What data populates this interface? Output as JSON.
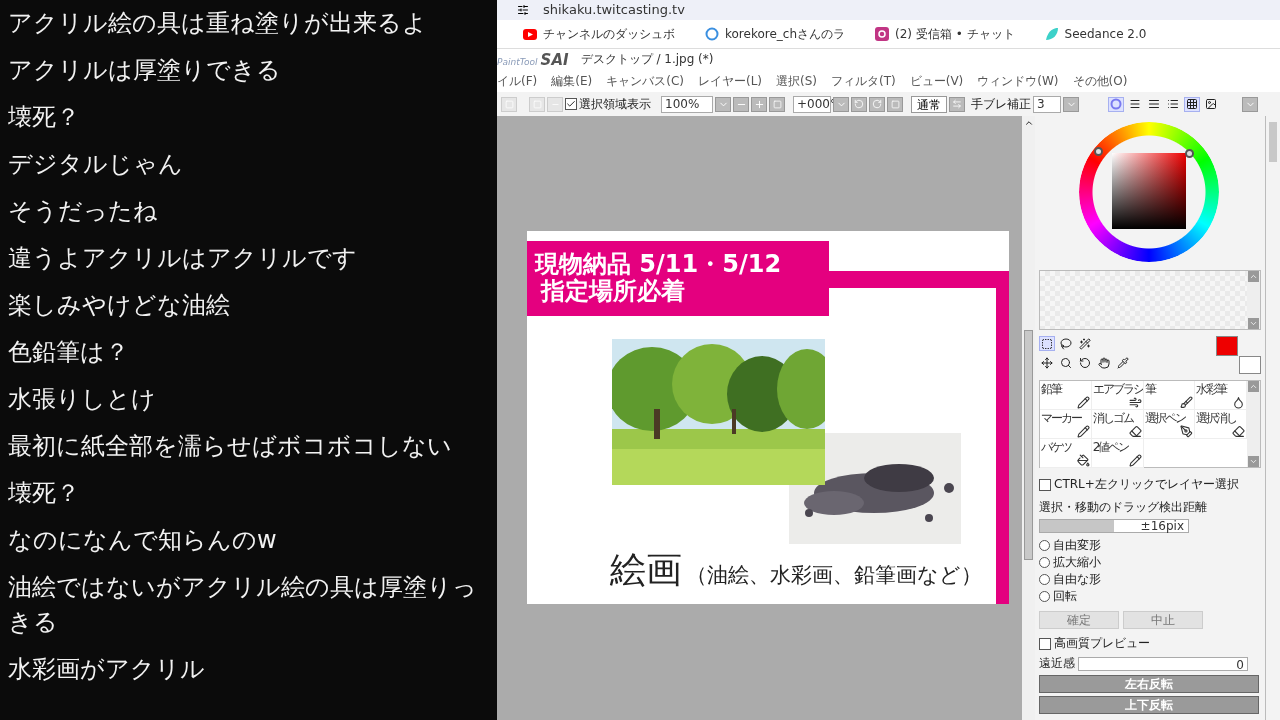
{
  "chat": {
    "messages": [
      {
        "lines": [
          "アクリル絵の具は重ね塗りが出来るよ"
        ]
      },
      {
        "lines": [
          "アクリルは厚塗りできる"
        ]
      },
      {
        "lines": [
          "壊死？"
        ]
      },
      {
        "lines": [
          "デジタルじゃん"
        ]
      },
      {
        "lines": [
          "そうだったね"
        ]
      },
      {
        "lines": [
          "違うよアクリルはアクリルです"
        ]
      },
      {
        "lines": [
          "楽しみやけどな油絵"
        ]
      },
      {
        "lines": [
          "色鉛筆は？"
        ]
      },
      {
        "lines": [
          "水張りしとけ"
        ]
      },
      {
        "lines": [
          "最初に紙全部を濡らせばボコボコしない"
        ]
      },
      {
        "lines": [
          "壊死？"
        ]
      },
      {
        "lines": [
          "なのになんで知らんのw"
        ]
      },
      {
        "lines": [
          "油絵ではないがアクリル絵の具は厚塗りっ",
          "きる"
        ]
      },
      {
        "lines": [
          "水彩画がアクリル"
        ]
      }
    ]
  },
  "browser": {
    "url": "shikaku.twitcasting.tv",
    "bookmarks": [
      {
        "kind": "video",
        "label": "チャンネルのダッシュボ"
      },
      {
        "kind": "ring",
        "label": "korekore_chさんのラ"
      },
      {
        "label": "(2) 受信箱 • チャット"
      },
      {
        "kind": "leaf",
        "label": "Seedance 2.0"
      }
    ]
  },
  "sai": {
    "logo_small": "PaintTool",
    "logo": "SAI",
    "title": "デスクトップ / 1.jpg (*)",
    "menu": [
      "イル(F)",
      "編集(E)",
      "キャンバス(C)",
      "レイヤー(L)",
      "選択(S)",
      "フィルタ(T)",
      "ビュー(V)",
      "ウィンドウ(W)",
      "その他(O)"
    ],
    "toolbar": {
      "show_selection": {
        "label": "選択領域表示",
        "checked": true
      },
      "zoom": "100%",
      "angle": "+000°",
      "blend": "通常",
      "stabilizer_label": "手ブレ補正",
      "stabilizer": "3"
    },
    "slide": {
      "banner": [
        "現物納品 5/11・5/12",
        "指定場所必着"
      ],
      "heading": "絵画",
      "subheading": "（油絵、水彩画、鉛筆画など）"
    },
    "panel": {
      "tools": [
        {
          "label": "鉛筆",
          "kind": "pencil"
        },
        {
          "label": "エアブラシ",
          "kind": "airbrush"
        },
        {
          "label": "筆",
          "kind": "brush"
        },
        {
          "label": "水彩筆",
          "kind": "watercolor"
        },
        {
          "label": "マーカー",
          "kind": "pencil"
        },
        {
          "label": "消しゴム",
          "kind": "eraser"
        },
        {
          "label": "選択ペン",
          "kind": "selpen"
        },
        {
          "label": "選択消し",
          "kind": "selerase"
        },
        {
          "label": "バケツ",
          "kind": "bucket"
        },
        {
          "label": "2値ペン",
          "kind": "pencil"
        }
      ],
      "ctrl_select": {
        "label": "CTRL+左クリックでレイヤー選択",
        "checked": false
      },
      "drag_label": "選択・移動のドラッグ検出距離",
      "drag": {
        "reading": "±16pix",
        "level": 0.5
      },
      "transforms": [
        {
          "label": "自由変形",
          "selected": false
        },
        {
          "label": "拡大縮小",
          "selected": false
        },
        {
          "label": "自由な形",
          "selected": false
        },
        {
          "label": "回転",
          "selected": false
        }
      ],
      "confirm_buttons": [
        {
          "label": "確定",
          "disabled": true
        },
        {
          "label": "中止",
          "disabled": true
        }
      ],
      "hq_preview": {
        "label": "高画質プレビュー",
        "checked": false
      },
      "perspective": {
        "label": "遠近感",
        "value": "0"
      },
      "flip_buttons": [
        "左右反転",
        "上下反転"
      ]
    }
  }
}
